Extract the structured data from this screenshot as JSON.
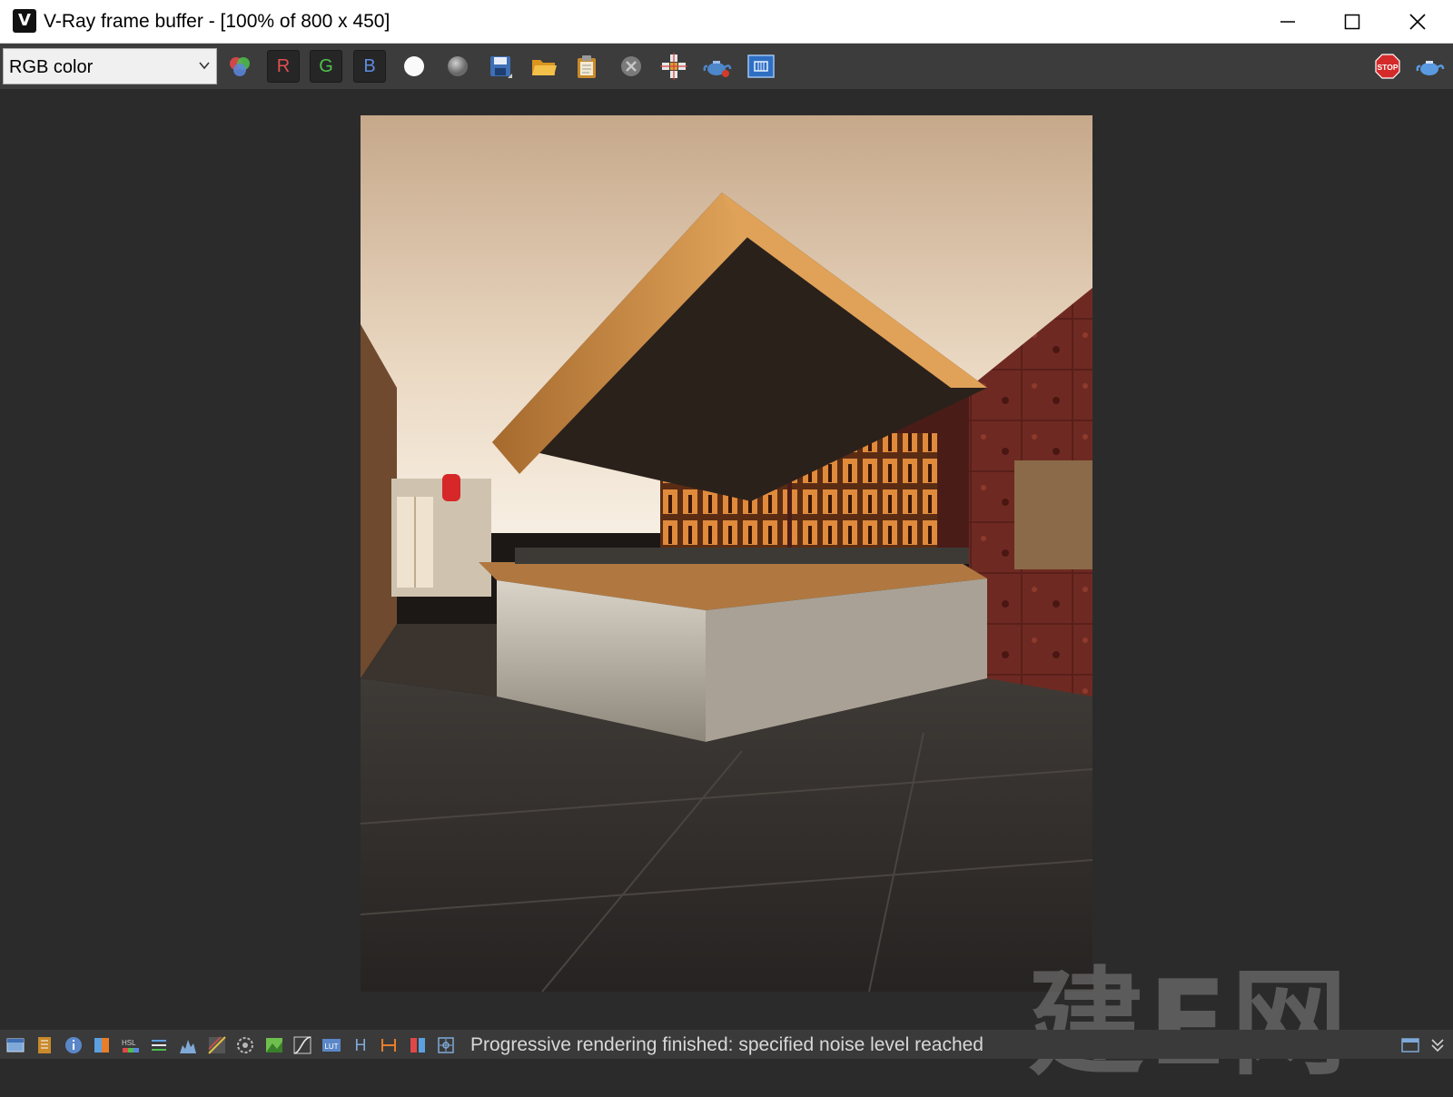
{
  "window": {
    "title": "V-Ray frame buffer - [100% of 800 x 450]",
    "logo_glyph": "V",
    "controls": [
      "minimize-icon",
      "maximize-icon",
      "close-icon"
    ]
  },
  "toolbar": {
    "channel_select": {
      "value": "RGB color"
    },
    "channel_buttons": {
      "r": "R",
      "g": "G",
      "b": "B"
    },
    "icons": [
      "rgb-channels-icon",
      "white-circle-icon",
      "gray-circle-icon",
      "save-icon",
      "open-folder-icon",
      "clipboard-icon",
      "clear-icon",
      "track-mouse-icon",
      "render-teapot-icon",
      "region-render-icon",
      "stop-icon",
      "render-teapot-icon"
    ],
    "stop_label": "STOP",
    "colors": {
      "r": "#e05050",
      "g": "#4fc24f",
      "b": "#5c8be0",
      "stop": "#d42a2a",
      "accent": "#2e6fc4"
    }
  },
  "canvas": {
    "watermark": "建E网"
  },
  "statusbar": {
    "icons": [
      "window-icon",
      "history-icon",
      "info-icon",
      "color-corrections-icon",
      "hsl-icon",
      "levels-icon",
      "histogram-icon",
      "curve-icon",
      "exposure-icon",
      "white-balance-icon",
      "curves-icon",
      "lut-icon",
      "h-icon",
      "width-icon",
      "compare-icon",
      "settings-icon"
    ],
    "hsl_label": "HSL",
    "lut_label": "LUT",
    "h_label": "H",
    "status_text": "Progressive rendering finished: specified noise level reached"
  }
}
